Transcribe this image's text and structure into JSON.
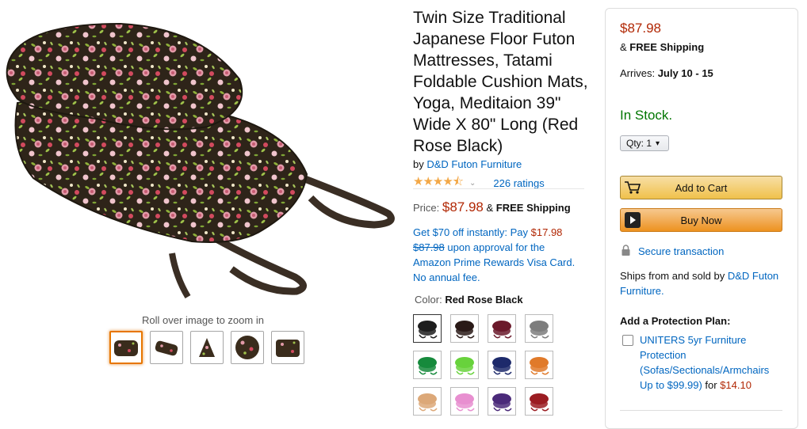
{
  "gallery": {
    "zoom_hint": "Roll over image to zoom in",
    "thumbnails": [
      "thumb-1",
      "thumb-2",
      "thumb-3",
      "thumb-4",
      "thumb-5"
    ],
    "selected_thumbnail": 1
  },
  "product": {
    "title": "Twin Size Traditional Japanese Floor Futon Mattresses, Tatami Foldable Cushion Mats, Yoga, Meditaion 39\" Wide X 80\" Long (Red Rose Black)",
    "by_prefix": "by",
    "brand": "D&D Futon Furniture",
    "rating_stars": "★★★★⯪",
    "rating_value": 4.5,
    "ratings_count": "226 ratings",
    "price_label": "Price:",
    "price": "$87.98",
    "shipping_connector": "&",
    "shipping": "FREE Shipping"
  },
  "promo": {
    "line1_text": "Get $70 off instantly: Pay",
    "pay_amount": "$17.98",
    "old_price": "$87.98",
    "line2_text": "upon approval for the Amazon Prime Rewards Visa Card. No annual fee."
  },
  "color": {
    "label": "Color:",
    "selected": "Red Rose Black",
    "swatches": [
      {
        "name": "black",
        "color": "#1e1e1e"
      },
      {
        "name": "dark-brown",
        "color": "#2a1a17"
      },
      {
        "name": "burgundy",
        "color": "#6b1a2b"
      },
      {
        "name": "gray",
        "color": "#7d7d7d"
      },
      {
        "name": "green",
        "color": "#168a3c"
      },
      {
        "name": "lime",
        "color": "#68d23c"
      },
      {
        "name": "navy",
        "color": "#1d2a6b"
      },
      {
        "name": "orange",
        "color": "#e07a2a"
      },
      {
        "name": "tan",
        "color": "#dca878"
      },
      {
        "name": "pink",
        "color": "#e88fd0"
      },
      {
        "name": "purple",
        "color": "#4b2a7a"
      },
      {
        "name": "red",
        "color": "#9b1c22"
      }
    ]
  },
  "buybox": {
    "price": "$87.98",
    "shipping_connector": "&",
    "shipping": "FREE Shipping",
    "arrives_label": "Arrives:",
    "arrives_date": "July 10 - 15",
    "stock": "In Stock.",
    "qty": "Qty: 1",
    "add_to_cart": "Add to Cart",
    "buy_now": "Buy Now",
    "secure": "Secure transaction",
    "ships_from_text": "Ships from and sold by",
    "seller": "D&D Futon Furniture.",
    "protection_title": "Add a Protection Plan:",
    "protection_link": "UNITERS 5yr Furniture Protection (Sofas/Sectionals/Armchairs Up to $99.99)",
    "protection_for": "for",
    "protection_price": "$14.10"
  },
  "colors": {
    "link": "#0066c0",
    "price": "#b12704",
    "in_stock": "#007600",
    "add_to_cart_bg": "#f0c14b",
    "buy_now_bg": "#ed9220",
    "thumb_selected_border": "#e77600"
  }
}
